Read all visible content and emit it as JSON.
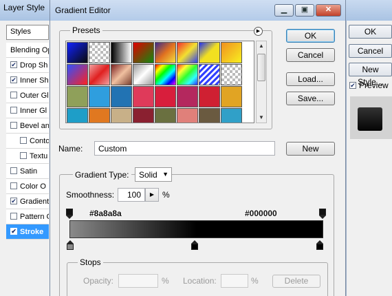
{
  "layer_style": {
    "title": "Layer Style",
    "styles_header": "Styles",
    "items": [
      {
        "label": "Blending Op",
        "checkbox": false,
        "checked": false,
        "sub": false,
        "selected": false
      },
      {
        "label": "Drop Sh",
        "checkbox": true,
        "checked": true,
        "sub": false,
        "selected": false
      },
      {
        "label": "Inner Sh",
        "checkbox": true,
        "checked": true,
        "sub": false,
        "selected": false
      },
      {
        "label": "Outer Gl",
        "checkbox": true,
        "checked": false,
        "sub": false,
        "selected": false
      },
      {
        "label": "Inner Gl",
        "checkbox": true,
        "checked": false,
        "sub": false,
        "selected": false
      },
      {
        "label": "Bevel an",
        "checkbox": true,
        "checked": false,
        "sub": false,
        "selected": false
      },
      {
        "label": "Conto",
        "checkbox": true,
        "checked": false,
        "sub": true,
        "selected": false
      },
      {
        "label": "Textu",
        "checkbox": true,
        "checked": false,
        "sub": true,
        "selected": false
      },
      {
        "label": "Satin",
        "checkbox": true,
        "checked": false,
        "sub": false,
        "selected": false
      },
      {
        "label": "Color O",
        "checkbox": true,
        "checked": false,
        "sub": false,
        "selected": false
      },
      {
        "label": "Gradient",
        "checkbox": true,
        "checked": true,
        "sub": false,
        "selected": false
      },
      {
        "label": "Pattern C",
        "checkbox": true,
        "checked": false,
        "sub": false,
        "selected": false
      },
      {
        "label": "Stroke",
        "checkbox": true,
        "checked": true,
        "sub": false,
        "selected": true
      }
    ],
    "ok_label": "OK",
    "cancel_label": "Cancel",
    "new_style_label": "New Style...",
    "preview_label": "Preview",
    "preview_checked": true
  },
  "gradient_editor": {
    "title": "Gradient Editor",
    "presets_label": "Presets",
    "presets": [
      "linear-gradient(135deg,#1022ff,#0a0a0a)",
      "repeating-conic-gradient(#bbb 0 25%,#fff 0 50%) 0 0/8px 8px, linear-gradient(#2a3bff,#2a3bff)",
      "linear-gradient(90deg,#000,#fff)",
      "linear-gradient(135deg,#e00000,#108a10)",
      "linear-gradient(135deg,#3b2a8c,#e07020,#f2e040)",
      "linear-gradient(135deg,#f23030,#f2e030,#3040f0)",
      "linear-gradient(135deg,#2030f0,#f2e020,#f2e020)",
      "linear-gradient(135deg,#f09020,#f8f020)",
      "linear-gradient(135deg,#3050ff,#ff2020)",
      "linear-gradient(135deg,#f0a0a0,#e02020,#f0a0a0)",
      "linear-gradient(135deg,#7a2020,#f0c0a0,#7a4030)",
      "linear-gradient(135deg,#9a9a9a,#ffffff,#9a9a9a)",
      "linear-gradient(135deg,#ff0000,#ffff00,#00ff00,#00ffff,#0000ff,#ff00ff)",
      "linear-gradient(135deg,#ff3030,#ffff30,#30ff30,#30ffff,#3030ff)",
      "repeating-linear-gradient(135deg,#3040ff 0 3px,#fff 3px 6px)",
      "repeating-conic-gradient(#bbb 0 25%,#fff 0 50%) 0 0/8px 8px",
      "linear-gradient(#8fa05a,#8fa05a)",
      "linear-gradient(#2f9ede,#2f9ede)",
      "linear-gradient(#2273b3,#2273b3)",
      "linear-gradient(#df3a5a,#df3a5a)",
      "linear-gradient(#d81e3c,#d81e3c)",
      "linear-gradient(#b4285e,#b4285e)",
      "linear-gradient(#cf2032,#cf2032)",
      "linear-gradient(#e1a423,#e1a423)",
      "linear-gradient(#1e9ec8,#1e9ec8)",
      "linear-gradient(#e07820,#e07820)",
      "linear-gradient(#c8b088,#c8b088)",
      "linear-gradient(#8a2030,#8a2030)",
      "linear-gradient(#6a7040,#6a7040)",
      "linear-gradient(#e0807a,#e0807a)",
      "linear-gradient(#6a5a40,#6a5a40)",
      "linear-gradient(#30a0c8,#30a0c8)"
    ],
    "ok_label": "OK",
    "cancel_label": "Cancel",
    "load_label": "Load...",
    "save_label": "Save...",
    "name_label": "Name:",
    "name_value": "Custom",
    "new_label": "New",
    "gradient_type_label": "Gradient Type:",
    "gradient_type_value": "Solid",
    "smoothness_label": "Smoothness:",
    "smoothness_value": "100",
    "smoothness_unit": "%",
    "color_stop_left": "#8a8a8a",
    "color_stop_right": "#000000",
    "stop_left_hex_label": "#8a8a8a",
    "stop_right_hex_label": "#000000",
    "stops_label": "Stops",
    "opacity_label": "Opacity:",
    "opacity_unit": "%",
    "location_label": "Location:",
    "location_unit": "%",
    "delete_label": "Delete"
  }
}
